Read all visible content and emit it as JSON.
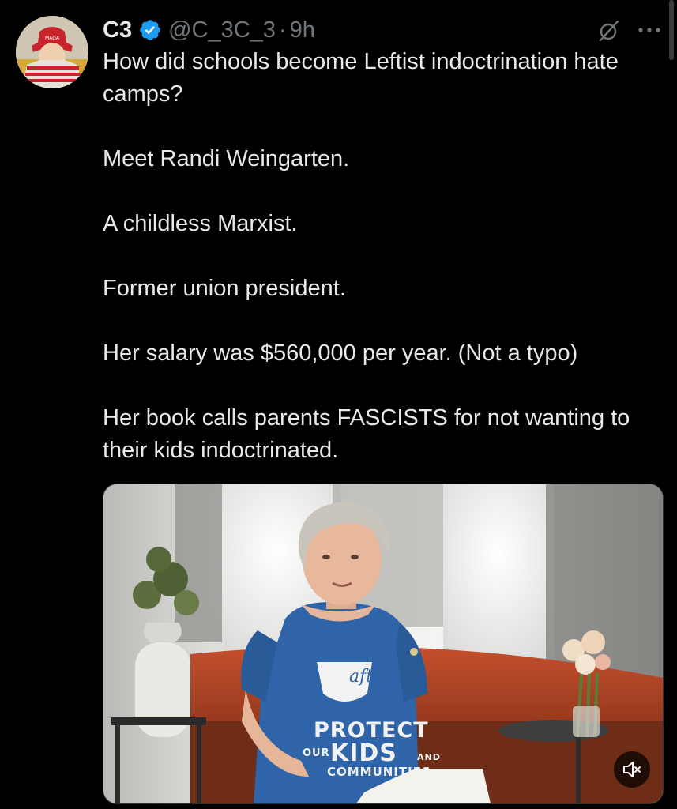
{
  "tweet": {
    "display_name": "C3",
    "handle": "@C_3C_3",
    "separator": "·",
    "timestamp": "9h",
    "paragraphs": [
      "How did schools become Leftist indoctrination hate camps?",
      "Meet Randi Weingarten.",
      "A childless Marxist.",
      "Former union president.",
      "Her salary was $560,000 per year. (Not a typo)",
      "Her book calls parents FASCISTS for not wanting to their kids indoctrinated."
    ]
  },
  "media": {
    "shirt": {
      "logo": "aft",
      "line1": "PROTECT",
      "line2a": "OUR",
      "line2b": "KIDS",
      "line2c": "AND",
      "line3": "COMMUNITIES"
    },
    "mute_icon": "speaker-muted-icon"
  },
  "icons": {
    "verified": "verified-badge-icon",
    "grok": "grok-icon",
    "more": "more-options-icon"
  },
  "colors": {
    "background": "#000000",
    "text": "#e7e9ea",
    "secondary_text": "#71767b",
    "verified_blue": "#1d9bf0",
    "shirt_blue": "#2f64a8"
  }
}
